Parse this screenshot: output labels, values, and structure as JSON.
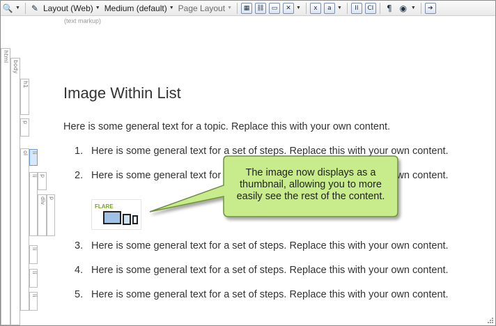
{
  "toolbar": {
    "layout_label": "Layout (Web)",
    "medium_label": "Medium (default)",
    "page_layout_label": "Page Layout",
    "icons": [
      "zoom-icon",
      "track-changes-icon",
      "layout-icon",
      "medium-icon",
      "page-layout-icon",
      "insert-image-icon",
      "insert-link-icon",
      "insert-picture-icon",
      "insert-symbol-icon",
      "text-icon",
      "variable-icon",
      "condition-icon",
      "snippet-icon",
      "paragraph-icon",
      "show-tags-icon",
      "preview-icon"
    ]
  },
  "markup_label": "(text markup)",
  "structure": {
    "labels": {
      "html": "html",
      "body": "body",
      "h1": "h1",
      "p": "p",
      "ol": "ol",
      "li": "li",
      "div": "div"
    }
  },
  "document": {
    "heading": "Image Within List",
    "intro": "Here is some general text for a topic. Replace this with your own content.",
    "steps": [
      {
        "num": "1.",
        "text": "Here is some general text for a set of steps. Replace this with your own content."
      },
      {
        "num": "2.",
        "text": "Here is some general text for a set of steps. Replace this with your own content."
      },
      {
        "num": "3.",
        "text": "Here is some general text for a set of steps. Replace this with your own content."
      },
      {
        "num": "4.",
        "text": "Here is some general text for a set of steps. Replace this with your own content."
      },
      {
        "num": "5.",
        "text": "Here is some general text for a set of steps. Replace this with your own content."
      }
    ],
    "thumbnail_logo": "FLARE"
  },
  "callout": {
    "text": "The image now displays as a thumbnail, allowing you to more easily see the rest of the content.",
    "fill": "#c8ec8c",
    "stroke": "#6f8f3a"
  }
}
